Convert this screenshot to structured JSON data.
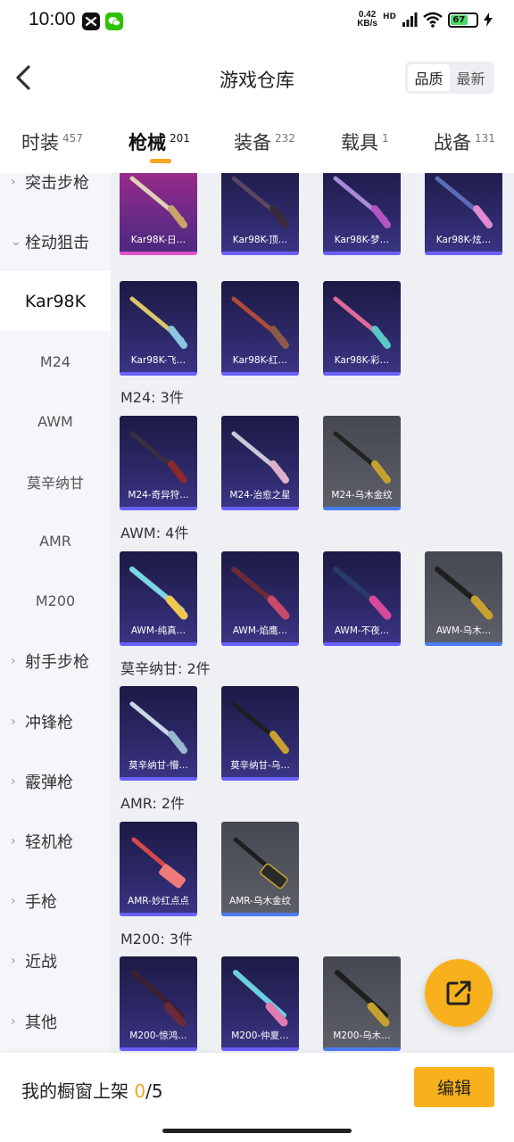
{
  "status_bar": {
    "time": "10:00",
    "net_speed_value": "0.42",
    "net_speed_unit": "KB/s",
    "network_type": "HD",
    "battery_level": "67"
  },
  "header": {
    "title": "游戏仓库",
    "sort_quality": "品质",
    "sort_newest": "最新"
  },
  "tabs": [
    {
      "label": "时装",
      "count": "457"
    },
    {
      "label": "枪械",
      "count": "201"
    },
    {
      "label": "装备",
      "count": "232"
    },
    {
      "label": "载具",
      "count": "1"
    },
    {
      "label": "战备",
      "count": "131"
    }
  ],
  "sidebar": {
    "assault_rifle": "突击步枪",
    "bolt_sniper": "栓动狙击",
    "kar98k": "Kar98K",
    "m24": "M24",
    "awm": "AWM",
    "mosin": "莫辛纳甘",
    "amr": "AMR",
    "m200": "M200",
    "marksman": "射手步枪",
    "smg": "冲锋枪",
    "shotgun": "霰弹枪",
    "lmg": "轻机枪",
    "pistol": "手枪",
    "melee": "近战",
    "other": "其他"
  },
  "sections": {
    "m24_title": "M24: 3件",
    "awm_title": "AWM: 4件",
    "mosin_title": "莫辛纳甘: 2件",
    "amr_title": "AMR: 2件",
    "m200_title": "M200: 3件"
  },
  "cards": {
    "kar_1": "Kar98K-日…",
    "kar_2": "Kar98K-顶…",
    "kar_3": "Kar98K-梦…",
    "kar_4": "Kar98K-炫…",
    "kar_5": "Kar98K-飞…",
    "kar_6": "Kar98K-红…",
    "kar_7": "Kar98K-彩…",
    "m24_1": "M24-奇异狩…",
    "m24_2": "M24-治愈之星",
    "m24_3": "M24-乌木金纹",
    "awm_1": "AWM-纯真…",
    "awm_2": "AWM-焰鹰…",
    "awm_3": "AWM-不夜…",
    "awm_4": "AWM-乌木…",
    "mosin_1": "莫辛纳甘-懵…",
    "mosin_2": "莫辛纳甘-乌…",
    "amr_1": "AMR-妙红点点",
    "amr_2": "AMR-乌木金纹",
    "m200_1": "M200-惊鸿…",
    "m200_2": "M200-仲夏…",
    "m200_3": "M200-乌木…"
  },
  "bottom": {
    "shop_label": "我的橱窗上架",
    "shop_count": "0",
    "shop_total": "/5",
    "edit_label": "编辑"
  },
  "colors": {
    "accent": "#f8b11d",
    "card_dark": "#2c2867",
    "card_pink": "#a52b8c",
    "card_grey": "#5d6068"
  }
}
